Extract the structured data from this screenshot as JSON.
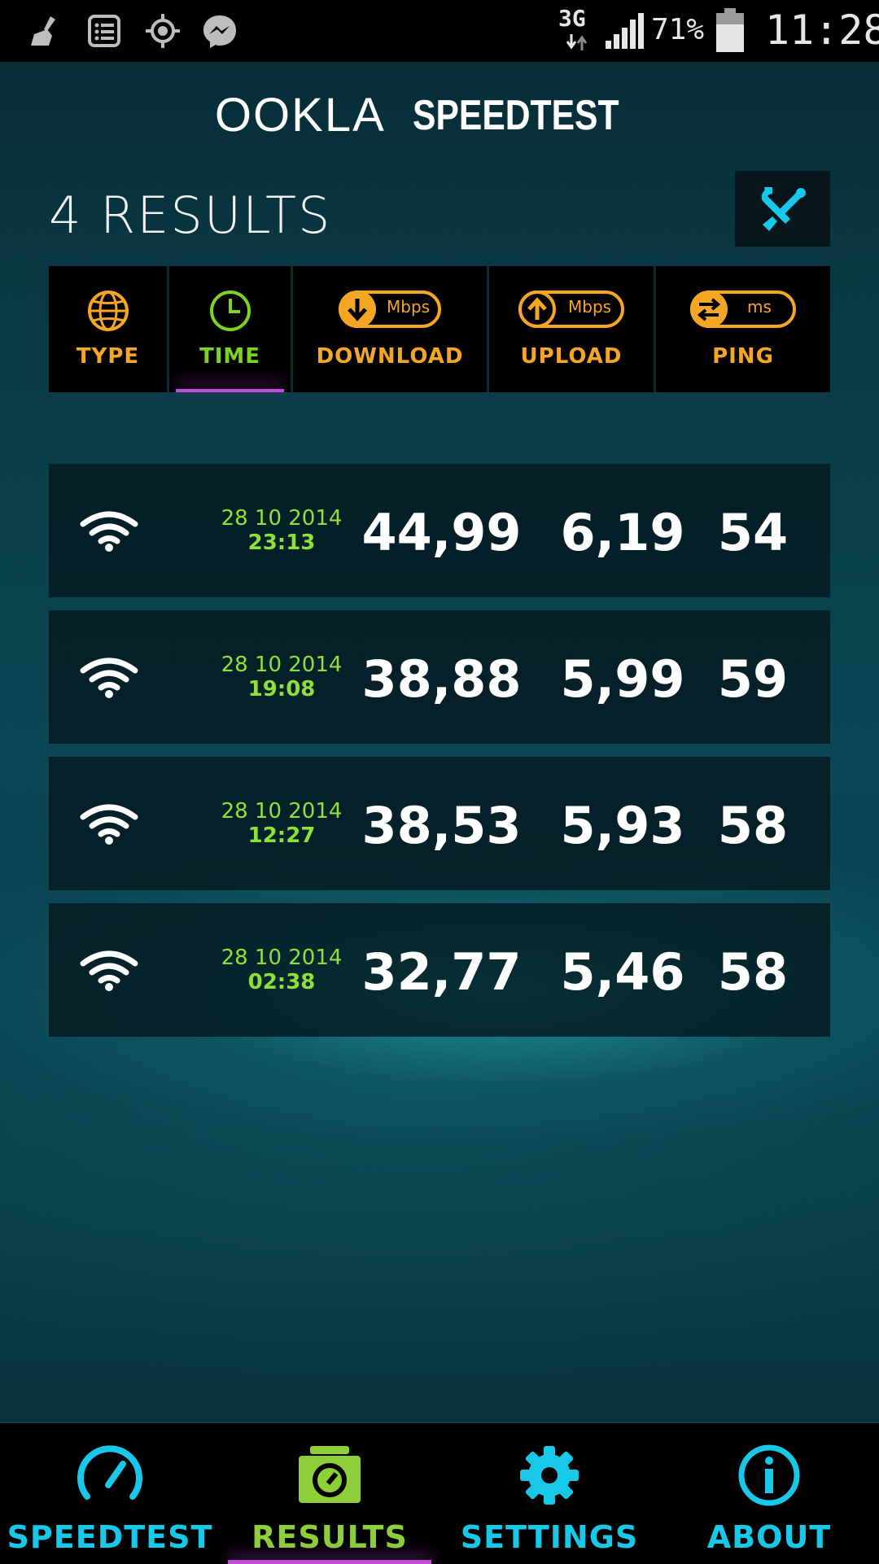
{
  "status_bar": {
    "network": "3G",
    "battery": "71%",
    "clock": "11:28",
    "left_icons": [
      "broom-icon",
      "list-icon",
      "gps-icon",
      "messenger-icon"
    ]
  },
  "header": {
    "brand_left": "OOKLA",
    "brand_right": "SPEEDTEST",
    "results_title": "4 RESULTS",
    "tools_icon": "wrench-screwdriver-icon"
  },
  "columns": [
    {
      "label": "TYPE",
      "icon": "globe-icon"
    },
    {
      "label": "TIME",
      "icon": "clock-icon",
      "active": true
    },
    {
      "label": "DOWNLOAD",
      "icon": "download-arrow-icon",
      "unit": "Mbps"
    },
    {
      "label": "UPLOAD",
      "icon": "upload-arrow-icon",
      "unit": "Mbps"
    },
    {
      "label": "PING",
      "icon": "ping-arrows-icon",
      "unit": "ms"
    }
  ],
  "results": [
    {
      "type": "wifi-icon",
      "date": "28 10 2014",
      "time": "23:13",
      "download": "44,99",
      "upload": "6,19",
      "ping": "54"
    },
    {
      "type": "wifi-icon",
      "date": "28 10 2014",
      "time": "19:08",
      "download": "38,88",
      "upload": "5,99",
      "ping": "59"
    },
    {
      "type": "wifi-icon",
      "date": "28 10 2014",
      "time": "12:27",
      "download": "38,53",
      "upload": "5,93",
      "ping": "58"
    },
    {
      "type": "wifi-icon",
      "date": "28 10 2014",
      "time": "02:38",
      "download": "32,77",
      "upload": "5,46",
      "ping": "58"
    }
  ],
  "bottom_nav": [
    {
      "label": "SPEEDTEST",
      "icon": "speedometer-icon"
    },
    {
      "label": "RESULTS",
      "icon": "results-folder-icon",
      "active": true
    },
    {
      "label": "SETTINGS",
      "icon": "gear-icon"
    },
    {
      "label": "ABOUT",
      "icon": "info-icon"
    }
  ],
  "colors": {
    "accent_orange": "#f5a623",
    "accent_green": "#8ee03a",
    "accent_cyan": "#18c8e8",
    "accent_purple": "#c44bd6"
  }
}
